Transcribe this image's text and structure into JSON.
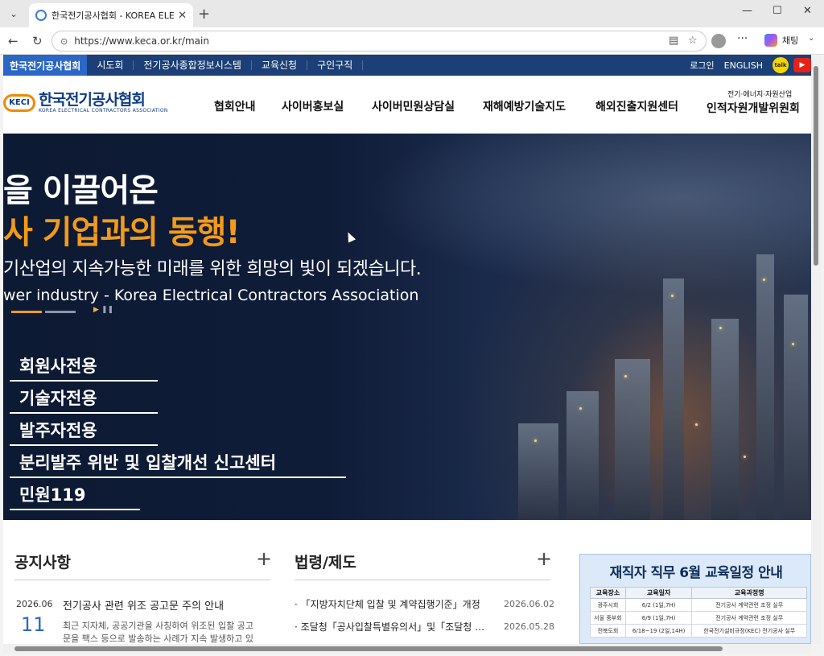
{
  "browser": {
    "tab_title": "한국전기공사협회 - KOREA ELECTI",
    "url": "https://www.keca.or.kr/main",
    "copilot_label": "채팅"
  },
  "topbar": {
    "home": "한국전기공사협회",
    "links": [
      "시도회",
      "전기공사종합정보시스템",
      "교육신청",
      "구인구직"
    ],
    "login": "로그인",
    "english": "ENGLISH"
  },
  "header": {
    "logo_mark": "KECI",
    "logo_kor": "한국전기공사협회",
    "logo_eng": "KOREA ELECTRICAL CONTRACTORS ASSOCIATION",
    "nav": [
      "협회안내",
      "사이버홍보실",
      "사이버민원상담실",
      "재해예방기술지도",
      "해외진출지원센터",
      "인적자원개발위원회"
    ],
    "nav_sub": "전기·에너지·자원산업"
  },
  "hero": {
    "line1": "을 이끌어온",
    "line2": "사 기업과의 동행!",
    "line3": "기산업의 지속가능한 미래를 위한 희망의 빛이 되겠습니다.",
    "line4": "wer industry - Korea Electrical Contractors Association",
    "quick_links": [
      "회원사전용",
      "기술자전용",
      "발주자전용",
      "분리발주 위반 및 입찰개선 신고센터",
      "민원119"
    ]
  },
  "notice": {
    "title": "공지사항",
    "date": "2026.06",
    "day": "11",
    "item_title": "전기공사 관련 위조 공고문 주의 안내",
    "item_body": "최근 지자체, 공공기관을 사칭하여 위조된 입찰 공고문을 팩스 등으로 발송하는 사례가 지속 발생하고 있"
  },
  "law": {
    "title": "법령/제도",
    "items": [
      {
        "text": "· 「지방자치단체 입찰 및 계약집행기준」개정",
        "date": "2026.06.02"
      },
      {
        "text": "· 조달청「공사입찰특별유의서」및「조달청 …",
        "date": "2026.05.28"
      }
    ]
  },
  "banner": {
    "title": "재직자 직무 6월 교육일정 안내",
    "headers": [
      "교육장소",
      "교육일자",
      "교육과정명"
    ],
    "rows": [
      [
        "광주시회",
        "6/2 (1일,7H)",
        "전기공사 계약관련 조정 실무"
      ],
      [
        "서울 중부회",
        "6/9 (1일,7H)",
        "전기공사 계약관련 조정 실무"
      ],
      [
        "전북도회",
        "6/18~19 (2일,14H)",
        "한국전기설비규정(KEC) 전기공사 실무"
      ]
    ]
  },
  "colors": {
    "topbar": "#1b3f76",
    "accent_orange": "#f39a1a",
    "link_blue": "#2a67c7"
  }
}
